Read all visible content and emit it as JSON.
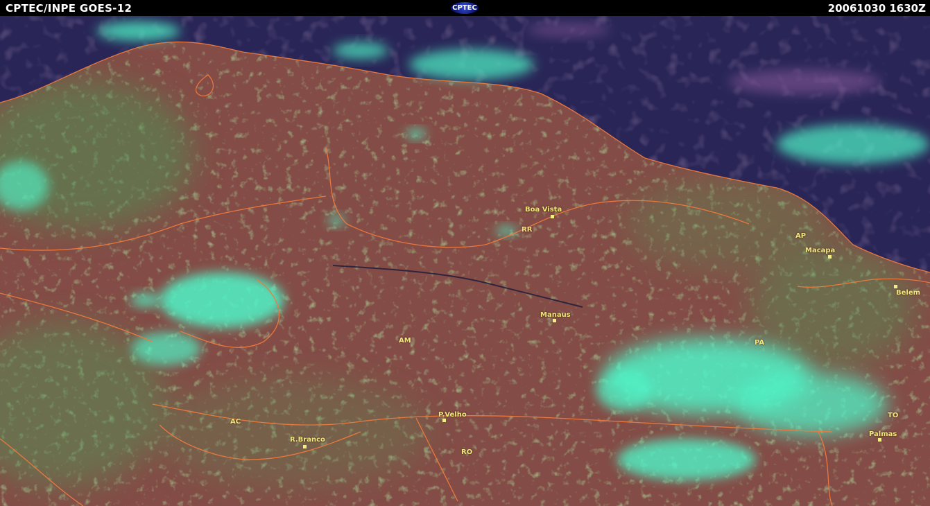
{
  "header": {
    "title": "CPTEC/INPE GOES-12",
    "timestamp": "20061030 1630Z",
    "logo_text": "CPTEC"
  },
  "map": {
    "label_color": "#f0e680",
    "border_color": "#f07a3c",
    "states": [
      "RR",
      "AP",
      "AM",
      "PA",
      "AC",
      "RO",
      "TO"
    ],
    "cities": [
      "Boa Vista",
      "Macapa",
      "Belem",
      "Manaus",
      "P.Velho",
      "R.Branco",
      "Palmas"
    ]
  }
}
